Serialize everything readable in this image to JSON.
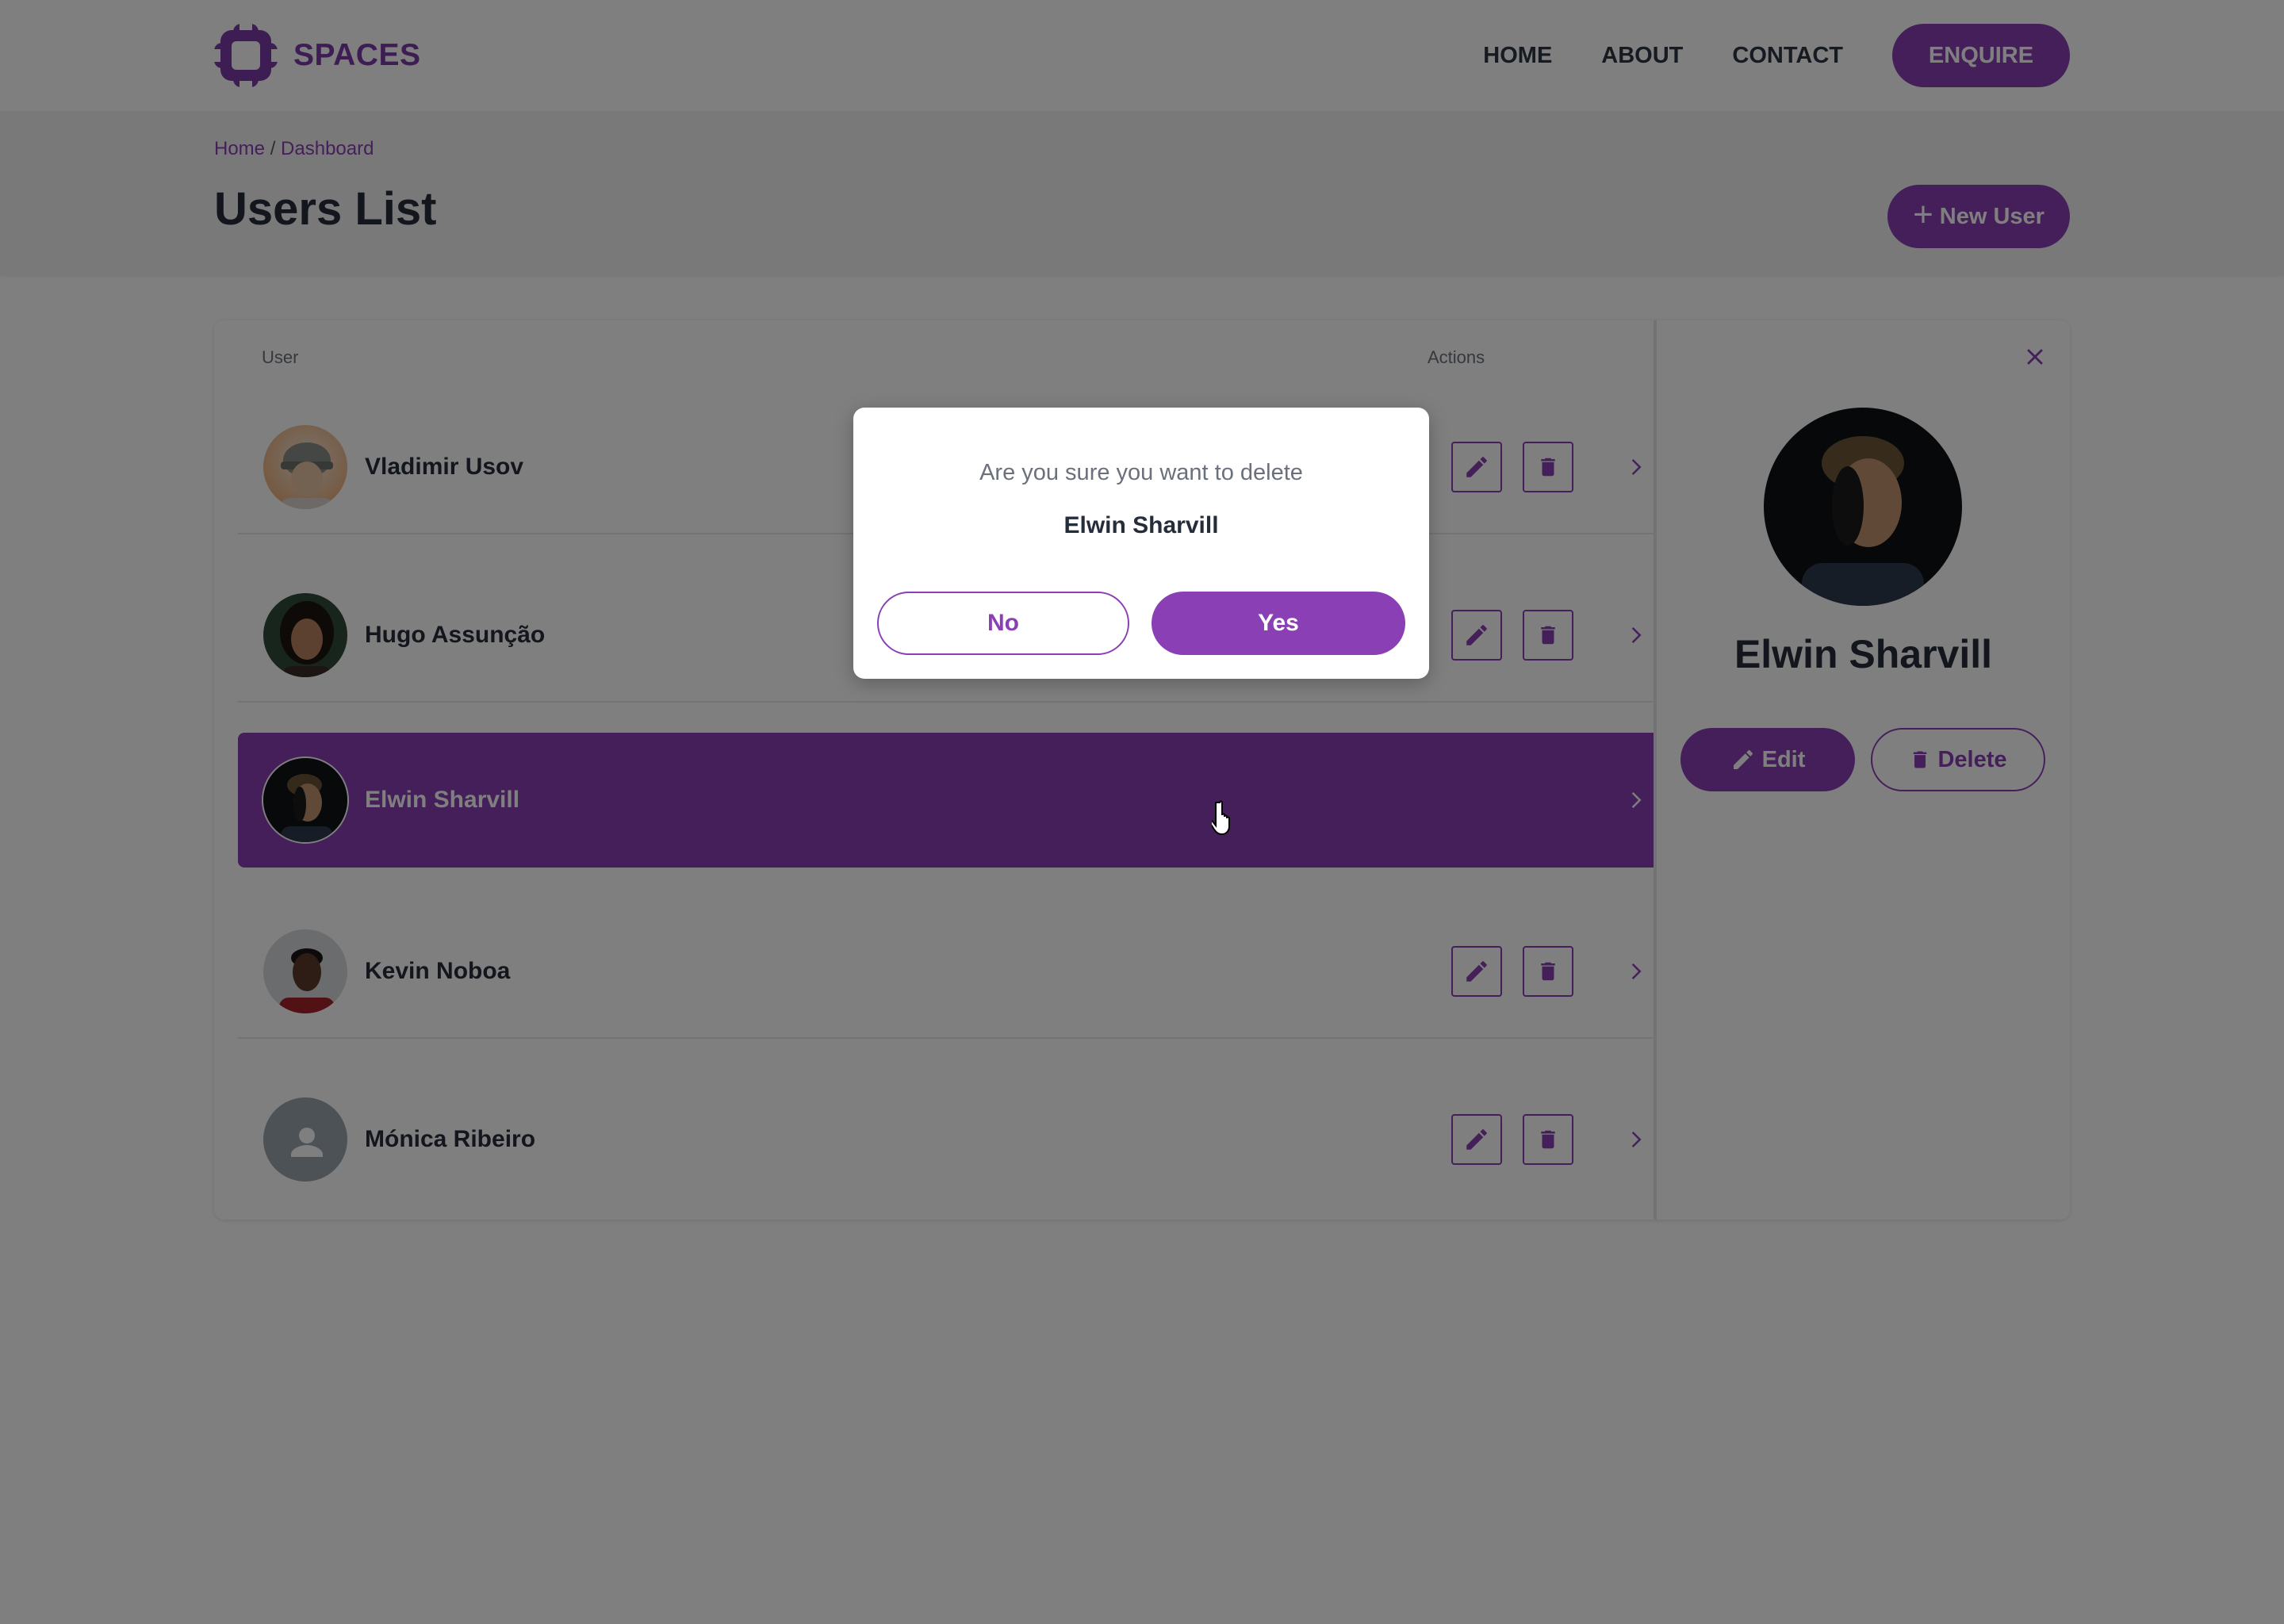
{
  "header": {
    "brand": "SPACES",
    "nav": [
      "HOME",
      "ABOUT",
      "CONTACT"
    ],
    "enquire_label": "ENQUIRE"
  },
  "breadcrumb": {
    "home": "Home",
    "separator": " / ",
    "current": "Dashboard"
  },
  "page_title": "Users List",
  "new_user_label": "New User",
  "table": {
    "col_user": "User",
    "col_actions": "Actions",
    "rows": [
      {
        "name": "Vladimir Usov",
        "avatar": "photo"
      },
      {
        "name": "Hugo Assunção",
        "avatar": "photo"
      },
      {
        "name": "Elwin Sharvill",
        "avatar": "photo",
        "selected": true
      },
      {
        "name": "Kevin Noboa",
        "avatar": "photo"
      },
      {
        "name": "Mónica Ribeiro",
        "avatar": "person-placeholder-icon"
      }
    ]
  },
  "detail": {
    "name": "Elwin Sharvill",
    "edit_label": "Edit",
    "delete_label": "Delete"
  },
  "modal": {
    "question": "Are you sure you want to delete",
    "name": "Elwin Sharvill",
    "no_label": "No",
    "yes_label": "Yes"
  },
  "colors": {
    "accent": "#8a3fb4",
    "text_dark": "#262d3a",
    "overlay": "rgba(0,0,0,0.5)"
  },
  "icons": [
    "logo-mark-icon",
    "plus-icon",
    "pencil-icon",
    "trash-icon",
    "chevron-right-icon",
    "close-icon",
    "person-icon",
    "hand-cursor-icon"
  ]
}
